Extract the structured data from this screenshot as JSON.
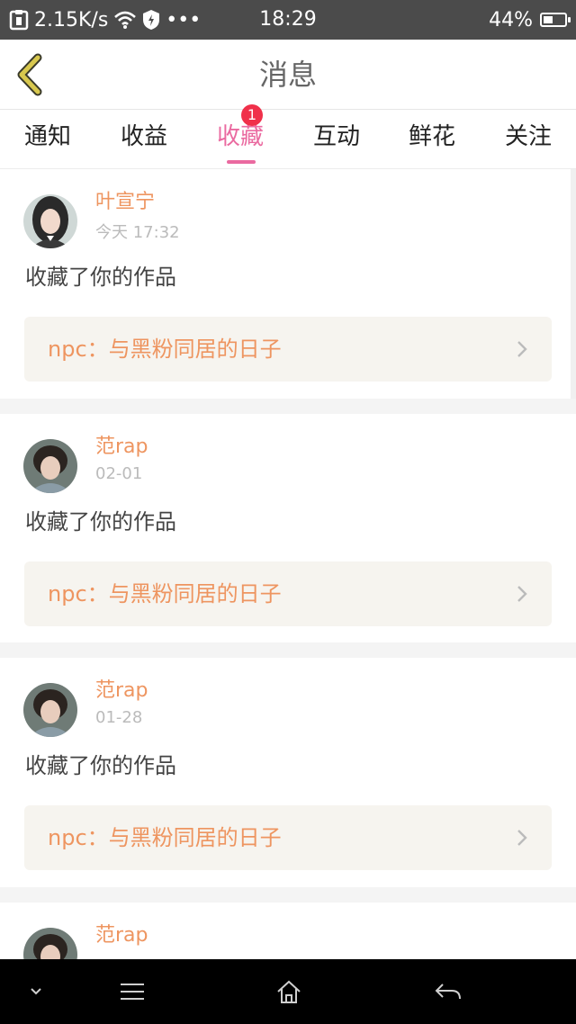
{
  "status_bar": {
    "net_speed": "2.15K/s",
    "dots": "•••",
    "time": "18:29",
    "battery": "44%",
    "battery_level": 0.44
  },
  "header": {
    "title": "消息"
  },
  "tabs": [
    {
      "label": "通知",
      "active": false
    },
    {
      "label": "收益",
      "active": false
    },
    {
      "label": "收藏",
      "active": true,
      "badge": "1"
    },
    {
      "label": "互动",
      "active": false
    },
    {
      "label": "鲜花",
      "active": false
    },
    {
      "label": "关注",
      "active": false
    }
  ],
  "items": [
    {
      "user": "叶宣宁",
      "date": "今天 17:32",
      "action": "收藏了你的作品",
      "work": "npc：与黑粉同居的日子"
    },
    {
      "user": "范rap",
      "date": "02-01",
      "action": "收藏了你的作品",
      "work": "npc：与黑粉同居的日子"
    },
    {
      "user": "范rap",
      "date": "01-28",
      "action": "收藏了你的作品",
      "work": "npc：与黑粉同居的日子"
    },
    {
      "user": "范rap",
      "date": "",
      "action": "",
      "work": ""
    }
  ],
  "colors": {
    "accent_pink": "#ea6aa0",
    "accent_orange": "#ee9560",
    "badge_red": "#f0304a",
    "back_arrow": "#c9b84a"
  }
}
